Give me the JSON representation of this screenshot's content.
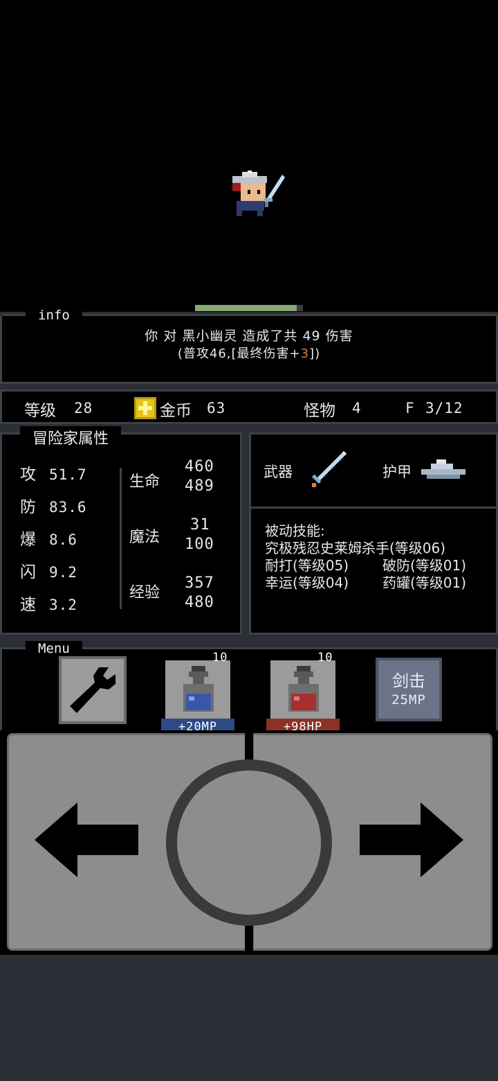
{
  "info": {
    "title": "info",
    "line1": "你 对 黑小幽灵 造成了共 49 伤害",
    "line2_prefix": "(普攻46,[最终伤害+",
    "line2_bonus": "3",
    "line2_suffix": "])",
    "monster_hp_fraction": 0.94
  },
  "status": {
    "level_label": "等级",
    "level_value": "28",
    "gold_label": "金币",
    "gold_value": "63",
    "monster_label": "怪物",
    "monster_value": "4",
    "floor_label": "F",
    "floor_value": "3/12"
  },
  "attributes": {
    "title": "冒险家属性",
    "stats": [
      {
        "label": "攻",
        "value": "51.7"
      },
      {
        "label": "防",
        "value": "83.6"
      },
      {
        "label": "爆",
        "value": "8.6"
      },
      {
        "label": "闪",
        "value": "9.2"
      },
      {
        "label": "速",
        "value": "3.2"
      }
    ],
    "hp_label": "生命",
    "hp_cur": "460",
    "hp_max": "489",
    "mp_label": "魔法",
    "mp_cur": "31",
    "mp_max": "100",
    "xp_label": "经验",
    "xp_cur": "357",
    "xp_max": "480"
  },
  "equipment": {
    "weapon_label": "武器",
    "weapon_icon": "sword-icon",
    "armor_label": "护甲",
    "armor_icon": "helmet-icon"
  },
  "skills": {
    "title": "被动技能:",
    "line1": "究极残忍史莱姆杀手(等级06)",
    "skill2": "耐打(等级05)",
    "skill3": "破防(等级01)",
    "skill4": "幸运(等级04)",
    "skill5": "药罐(等级01)"
  },
  "menu": {
    "title": "Menu",
    "wrench_icon": "wrench-icon",
    "mp_potion_count": "10",
    "mp_potion_label": "+20MP",
    "hp_potion_count": "10",
    "hp_potion_label": "+98HP",
    "skill_name": "剑击",
    "skill_cost": "25MP"
  },
  "colors": {
    "mp_potion": "#3a56a8",
    "hp_potion": "#a63030",
    "skill_button": "#6b7386",
    "bonus_text": "#e07a3a",
    "gold_icon": "#e6c41a"
  }
}
